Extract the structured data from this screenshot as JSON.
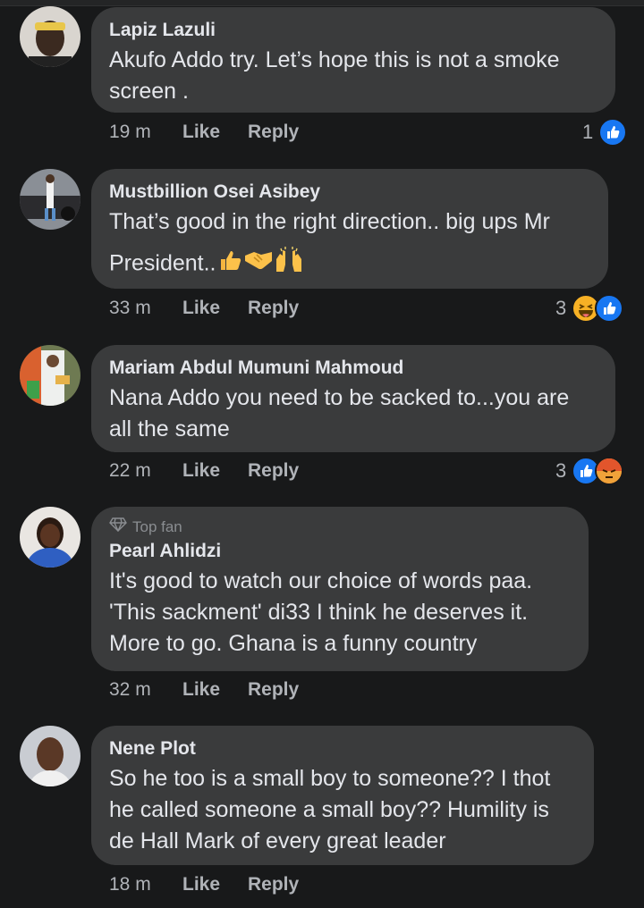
{
  "comments": [
    {
      "name": "Lapiz Lazuli",
      "lines": [
        "Akufo Addo try. Let’s hope this is not a smoke",
        "screen ."
      ],
      "time": "19 m",
      "like": "Like",
      "reply": "Reply",
      "reaction_count": "1",
      "reactions": [
        "like-icon"
      ]
    },
    {
      "name": "Mustbillion Osei Asibey",
      "lines": [
        "That’s good in the right direction.. big ups Mr",
        "President.."
      ],
      "emojis": [
        "thumbs-up-emoji",
        "handshake-emoji",
        "raising-hands-emoji"
      ],
      "time": "33 m",
      "like": "Like",
      "reply": "Reply",
      "reaction_count": "3",
      "reactions": [
        "haha-icon",
        "like-icon"
      ]
    },
    {
      "name": "Mariam Abdul Mumuni Mahmoud",
      "lines": [
        "Nana Addo you need to be sacked to...you are",
        "all the same"
      ],
      "time": "22 m",
      "like": "Like",
      "reply": "Reply",
      "reaction_count": "3",
      "reactions": [
        "like-icon",
        "angry-icon"
      ]
    },
    {
      "badge": "Top fan",
      "name": "Pearl Ahlidzi",
      "lines": [
        "It's good to watch our choice of words paa.",
        "'This sackment' di33 I think he deserves it.",
        "More to go. Ghana is a funny country"
      ],
      "time": "32 m",
      "like": "Like",
      "reply": "Reply"
    },
    {
      "name": "Nene Plot",
      "lines": [
        "So he too is a small boy to someone?? I thot",
        "he called someone a small boy?? Humility is",
        "de Hall Mark of every great leader"
      ],
      "time": "18 m",
      "like": "Like",
      "reply": "Reply"
    }
  ],
  "colors": {
    "background": "#18191a",
    "bubble": "#3a3b3c",
    "like_blue": "#1877f2",
    "haha_yellow": "#f7b125",
    "angry_orange": "#e9710f"
  }
}
